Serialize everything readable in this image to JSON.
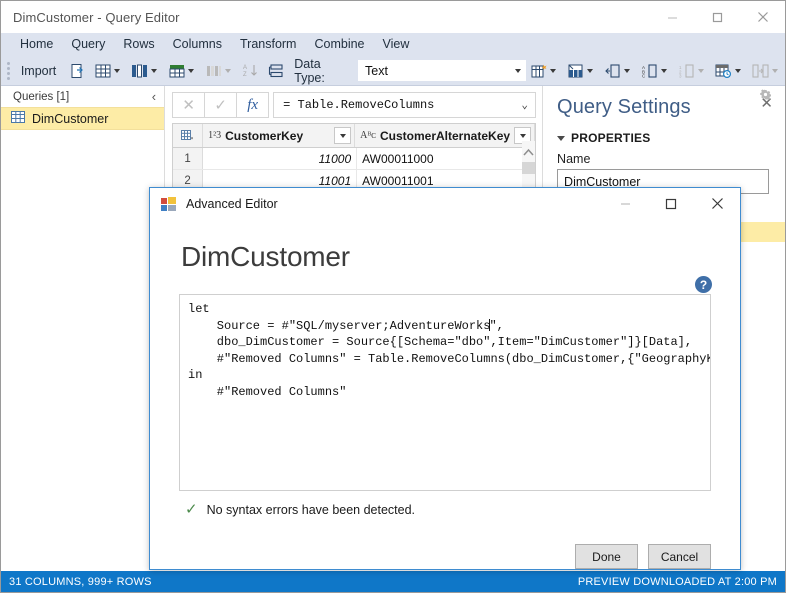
{
  "window": {
    "title": "DimCustomer - Query Editor",
    "buttons": {
      "minimize": "minimize-button",
      "maximize": "maximize-button",
      "close": "close-button"
    }
  },
  "ribbon": {
    "tabs": [
      {
        "label": "Home"
      },
      {
        "label": "Query"
      },
      {
        "label": "Rows"
      },
      {
        "label": "Columns"
      },
      {
        "label": "Transform"
      },
      {
        "label": "Combine"
      },
      {
        "label": "View"
      }
    ]
  },
  "toolbar": {
    "import_label": "Import",
    "data_type_label": "Data Type:",
    "data_type_value": "Text"
  },
  "queries_pane": {
    "header": "Queries [1]",
    "collapse_icon": "‹",
    "items": [
      {
        "label": "DimCustomer"
      }
    ]
  },
  "formula_bar": {
    "cancel_icon": "✕",
    "accept_icon": "✓",
    "fx_label": "fx",
    "value": "= Table.RemoveColumns",
    "expand_icon": "⌄"
  },
  "grid": {
    "columns": [
      {
        "type_badge": "1²3",
        "name": "CustomerKey",
        "align": "num"
      },
      {
        "type_badge": "Aᴮᴄ",
        "name": "CustomerAlternateKey",
        "align": "text"
      }
    ],
    "rows": [
      {
        "n": "1",
        "cells": [
          "11000",
          "AW00011000"
        ]
      },
      {
        "n": "2",
        "cells": [
          "11001",
          "AW00011001"
        ]
      }
    ]
  },
  "query_settings": {
    "title": "Query Settings",
    "close_icon": "✕",
    "properties_section": "PROPERTIES",
    "name_label": "Name",
    "name_value": "DimCustomer"
  },
  "status_bar": {
    "left": "31 COLUMNS, 999+ ROWS",
    "right": "PREVIEW DOWNLOADED AT 2:00 PM"
  },
  "advanced_editor": {
    "window_title": "Advanced Editor",
    "heading": "DimCustomer",
    "help_label": "?",
    "minimize_icon": "—",
    "maximize_icon": "☐",
    "close_icon": "✕",
    "code_line1": "let",
    "code_line2": "    Source = #\"SQL/myserver;AdventureWorks",
    "code_line2b": "\",",
    "code_line3": "    dbo_DimCustomer = Source{[Schema=\"dbo\",Item=\"DimCustomer\"]}[Data],",
    "code_line4": "    #\"Removed Columns\" = Table.RemoveColumns(dbo_DimCustomer,{\"GeographyKey\"})",
    "code_line5": "in",
    "code_line6": "    #\"Removed Columns\"",
    "syntax_check_icon": "✓",
    "syntax_message": "No syntax errors have been detected.",
    "done_label": "Done",
    "cancel_label": "Cancel"
  },
  "colors": {
    "ribbon_bg": "#dde3ef",
    "status_bar": "#0f77c8",
    "selection_yellow": "#fdeca6",
    "dialog_border": "#3f8cd0",
    "query_settings_title": "#3f5d86"
  }
}
